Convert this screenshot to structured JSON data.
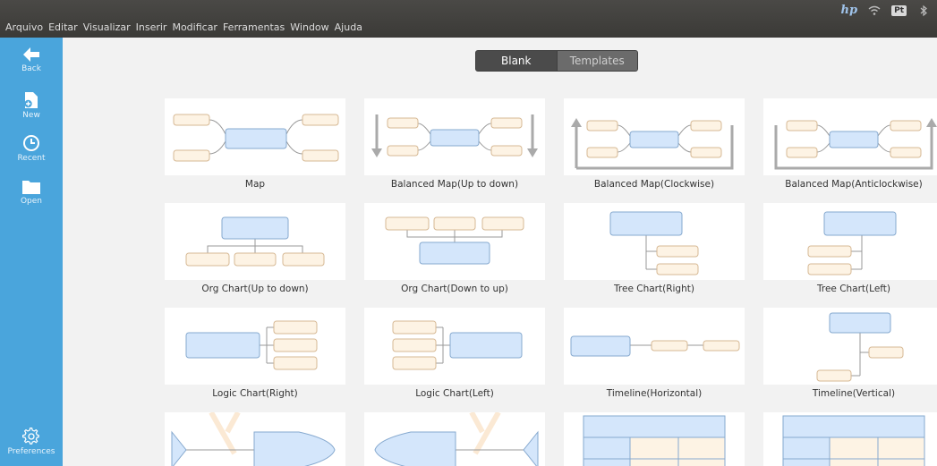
{
  "menubar": {
    "items": [
      "Arquivo",
      "Editar",
      "Visualizar",
      "Inserir",
      "Modificar",
      "Ferramentas",
      "Window",
      "Ajuda"
    ]
  },
  "tray": {
    "brand": "hp",
    "language": "Pt"
  },
  "sidebar": {
    "back": "Back",
    "new": "New",
    "recent": "Recent",
    "open": "Open",
    "preferences": "Preferences"
  },
  "tabs": {
    "blank": "Blank",
    "templates": "Templates",
    "selected": "Blank"
  },
  "templates": [
    {
      "label": "Map"
    },
    {
      "label": "Balanced Map(Up to down)"
    },
    {
      "label": "Balanced Map(Clockwise)"
    },
    {
      "label": "Balanced Map(Anticlockwise)"
    },
    {
      "label": "Org Chart(Up to down)"
    },
    {
      "label": "Org Chart(Down to up)"
    },
    {
      "label": "Tree Chart(Right)"
    },
    {
      "label": "Tree Chart(Left)"
    },
    {
      "label": "Logic Chart(Right)"
    },
    {
      "label": "Logic Chart(Left)"
    },
    {
      "label": "Timeline(Horizontal)"
    },
    {
      "label": "Timeline(Vertical)"
    },
    {
      "label": ""
    },
    {
      "label": ""
    },
    {
      "label": ""
    },
    {
      "label": ""
    }
  ],
  "colors": {
    "sidebar": "#4aa5dc",
    "central_node": "#d4e6fb",
    "central_border": "#86a9cf",
    "topic_node": "#fdf3e4",
    "topic_border": "#d6b894",
    "line": "#999999"
  }
}
